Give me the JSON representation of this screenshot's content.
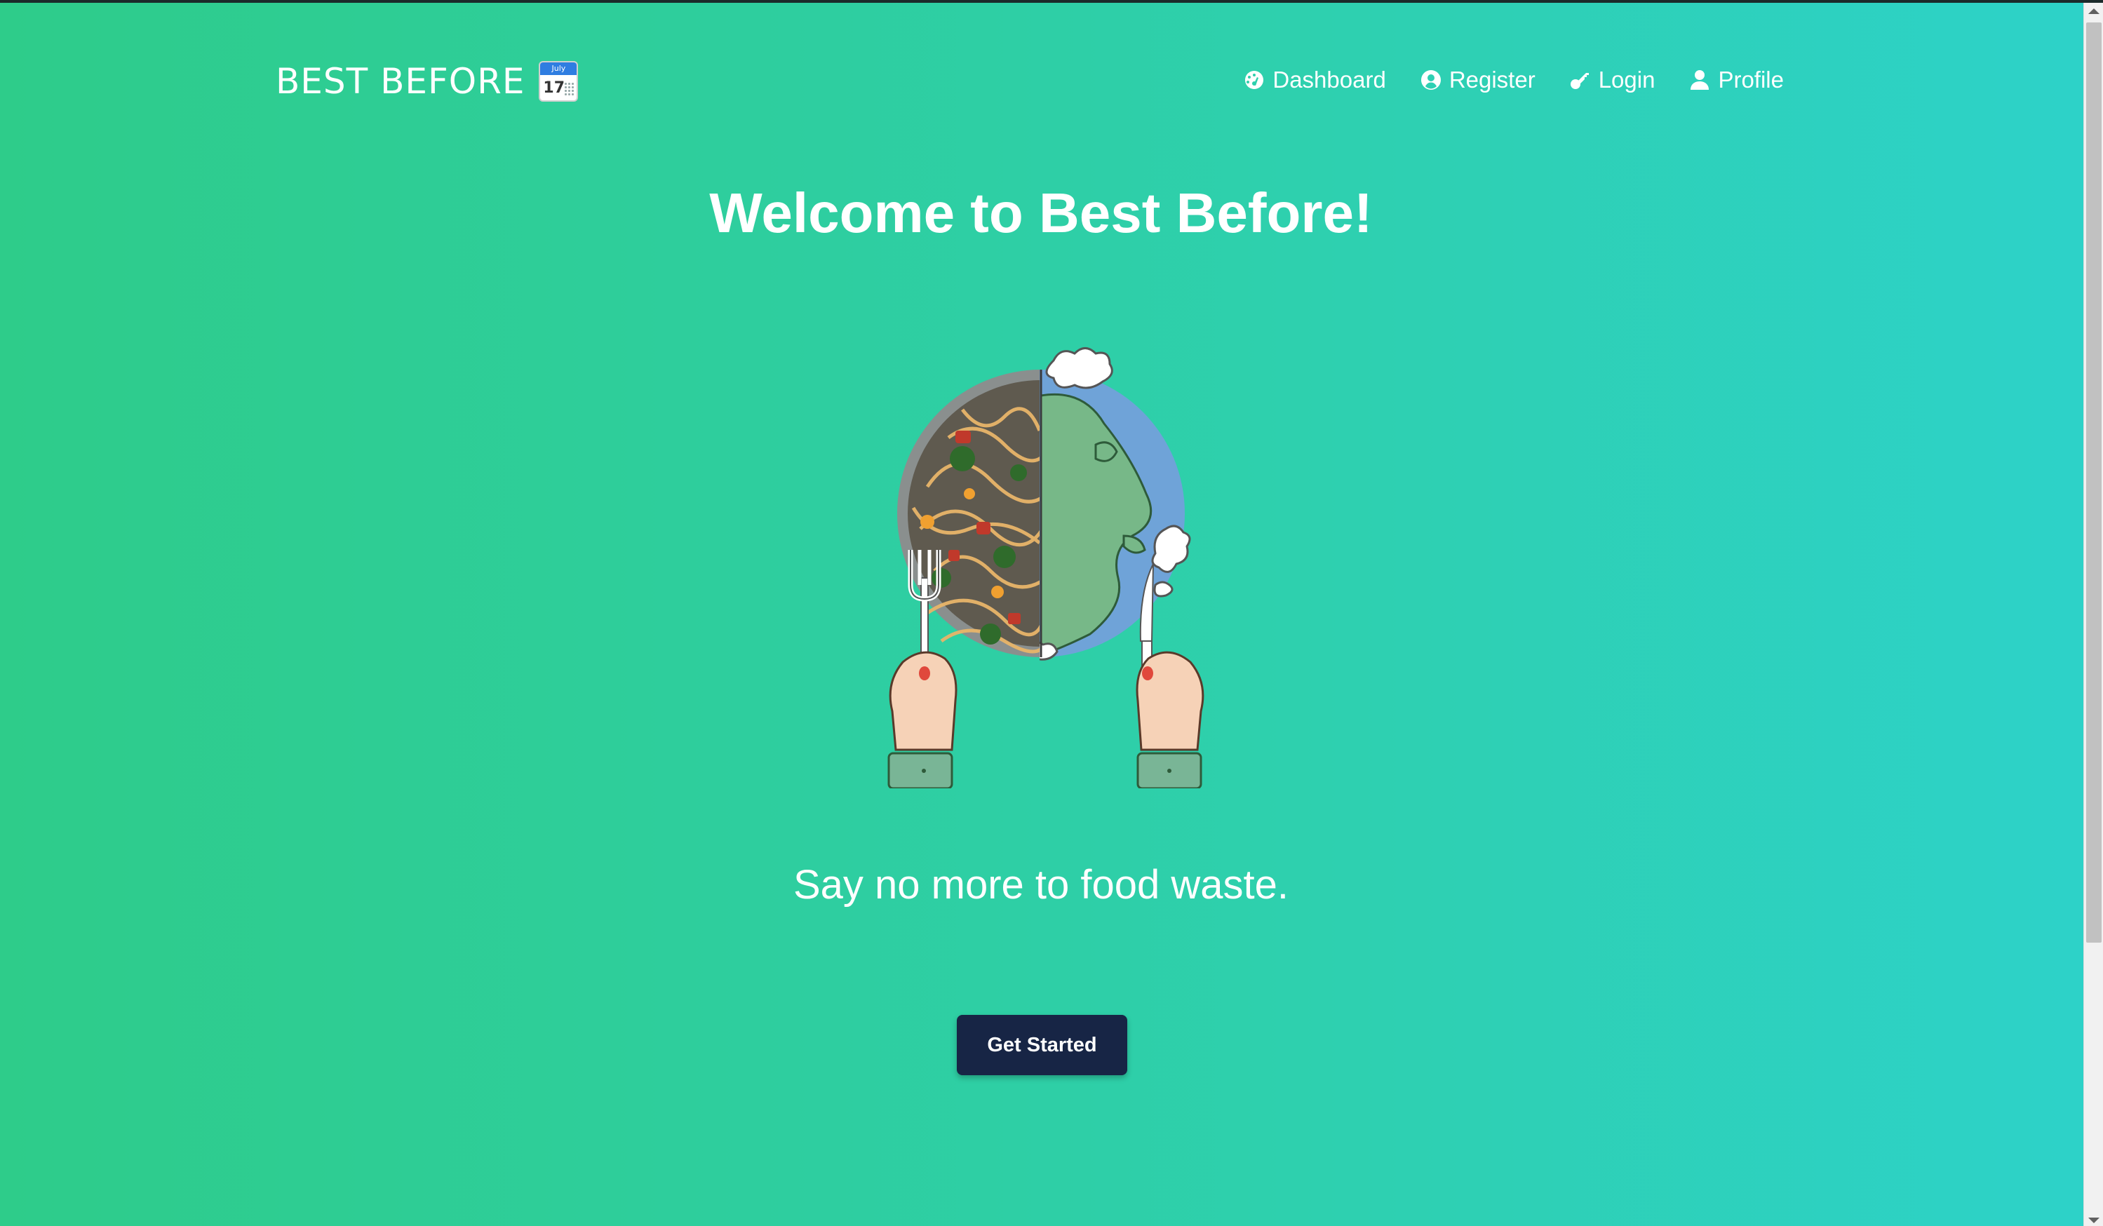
{
  "navbar": {
    "brand": "BEST BEFORE",
    "brand_icon": "calendar-icon",
    "calendar_icon": {
      "month": "July",
      "day": "17"
    },
    "items": [
      {
        "label": "Dashboard",
        "icon": "dashboard-icon"
      },
      {
        "label": "Register",
        "icon": "user-circle-icon"
      },
      {
        "label": "Login",
        "icon": "key-icon"
      },
      {
        "label": "Profile",
        "icon": "user-icon"
      }
    ]
  },
  "hero": {
    "title": "Welcome to Best Before!",
    "illustration": "plate-half-pasta-half-earth-with-fork-and-knife",
    "tagline": "Say no more to food waste.",
    "cta_label": "Get Started"
  },
  "colors": {
    "background_start": "#2ecc8a",
    "background_end": "#2dd2c9",
    "cta_background": "#172545",
    "text": "#ffffff"
  }
}
